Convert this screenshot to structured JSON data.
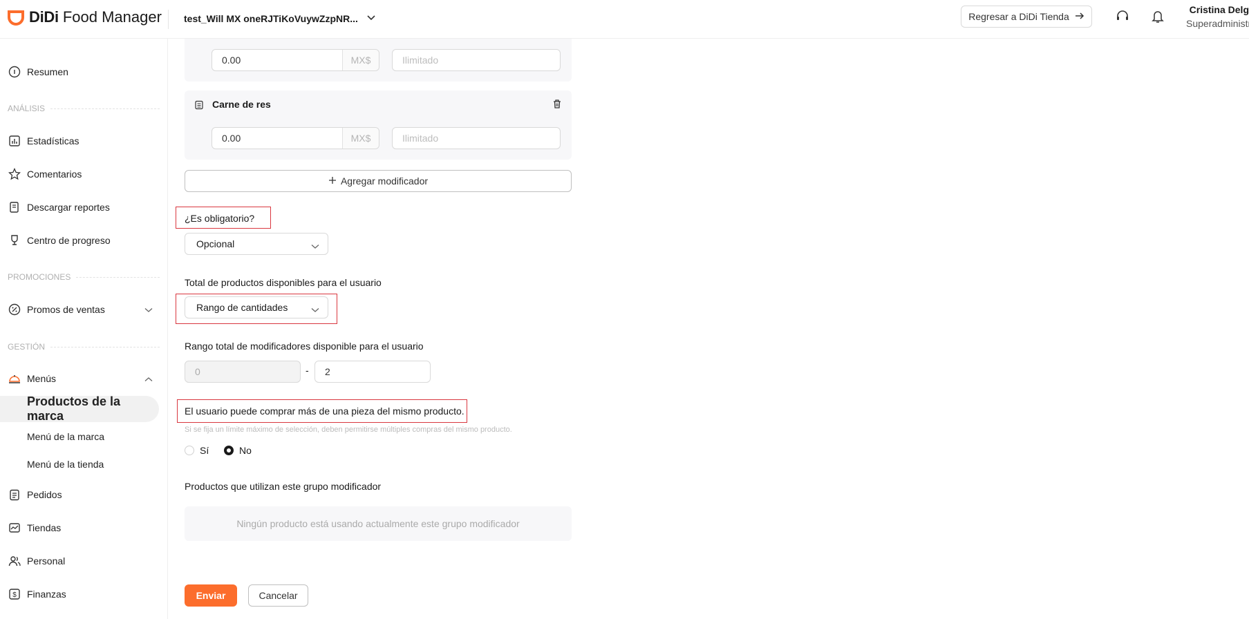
{
  "app": {
    "logo_brand": "DiDi",
    "logo_product": "Food Manager",
    "store_name": "test_Will MX oneRJTiKoVuywZzpNR...",
    "back_button": "Regresar a DiDi Tienda",
    "user_name": "Cristina Delg",
    "user_role": "Superadministr",
    "accent_color": "#fc6d2c"
  },
  "sidebar": {
    "resumen": "Resumen",
    "section_analisis": "ANÁLISIS",
    "estadisticas": "Estadísticas",
    "comentarios": "Comentarios",
    "descargar": "Descargar reportes",
    "progreso": "Centro de progreso",
    "section_promociones": "PROMOCIONES",
    "promos": "Promos de ventas",
    "section_gestion": "GESTIÓN",
    "menus": "Menús",
    "productos_marca": "Productos de la marca",
    "menu_marca": "Menú de la marca",
    "menu_tienda": "Menú de la tienda",
    "pedidos": "Pedidos",
    "tiendas": "Tiendas",
    "personal": "Personal",
    "finanzas": "Finanzas"
  },
  "form": {
    "modifier1_price": "0.00",
    "currency": "MX$",
    "limit_placeholder": "Ilimitado",
    "modifier2_name": "Carne de res",
    "modifier2_price": "0.00",
    "add_modifier": "Agregar modificador",
    "required_label": "¿Es obligatorio?",
    "required_value": "Opcional",
    "total_label": "Total de productos disponibles para el usuario",
    "total_value": "Rango de cantidades",
    "range_label": "Rango total de modificadores disponible para el usuario",
    "range_min": "0",
    "range_sep": "-",
    "range_max": "2",
    "multi_label": "El usuario puede comprar más de una pieza del mismo producto.",
    "multi_hint": "Si se fija un límite máximo de selección, deben permitirse múltiples compras del mismo producto.",
    "option_yes": "Sí",
    "option_no": "No",
    "selected_option": "No",
    "products_label": "Productos que utilizan este grupo modificador",
    "products_empty": "Ningún producto está usando actualmente este grupo modificador",
    "submit": "Enviar",
    "cancel": "Cancelar"
  }
}
